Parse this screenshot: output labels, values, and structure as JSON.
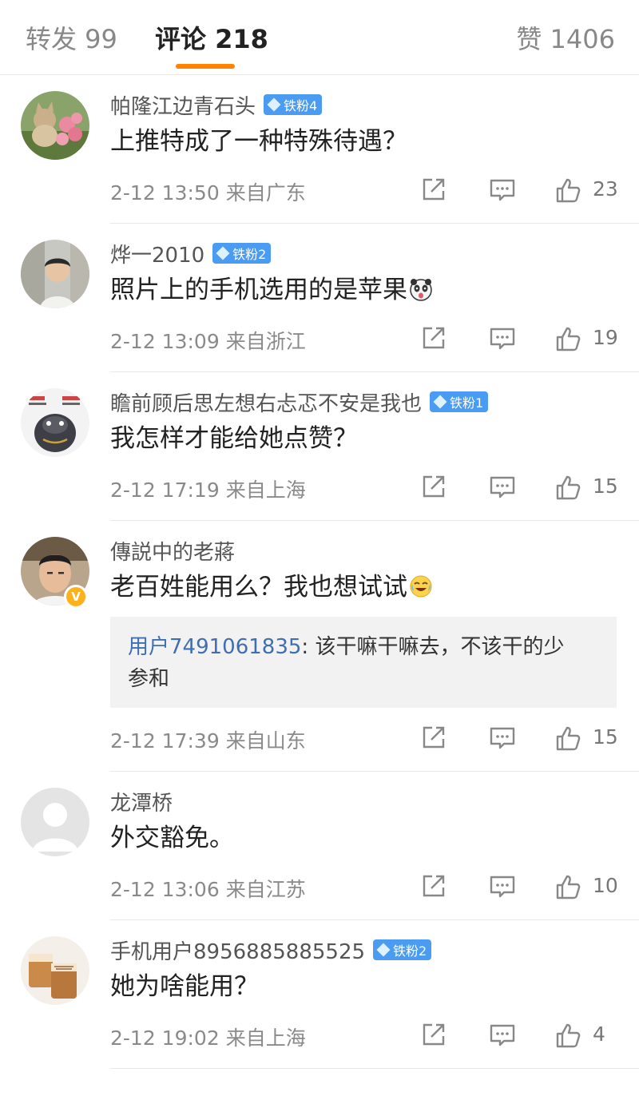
{
  "tabs": {
    "repost": "转发 99",
    "comments": "评论 218",
    "likes": "赞 1406",
    "active": "comments",
    "accent_color": "#ff8200"
  },
  "comments": [
    {
      "avatar": "cat-with-flowers-avatar",
      "name": "帕隆江边青石头",
      "badge": "铁粉4",
      "content": "上推特成了一种特殊待遇？",
      "time": "2-12 13:50",
      "location": "来自广东",
      "likes": "23"
    },
    {
      "avatar": "boy-photo-avatar",
      "name": "烨一2010",
      "badge": "铁粉2",
      "content": "照片上的手机选用的是苹果",
      "emoji": "panda-tongue-emoji",
      "time": "2-12 13:09",
      "location": "来自浙江",
      "likes": "19"
    },
    {
      "avatar": "meme-creature-avatar",
      "name": "瞻前顾后思左想右忐忑不安是我也",
      "badge": "铁粉1",
      "content": "我怎样才能给她点赞？",
      "time": "2-12 17:19",
      "location": "来自上海",
      "likes": "15"
    },
    {
      "avatar": "man-portrait-avatar",
      "verified": "V",
      "name": "傳説中的老蔣",
      "content": "老百姓能用么？我也想试试",
      "emoji": "laughing-crying-emoji",
      "reply": {
        "user": "用户7491061835",
        "text": ": 该干嘛干嘛去，不该干的少",
        "text2": "参和"
      },
      "time": "2-12 17:39",
      "location": "来自山东",
      "likes": "15"
    },
    {
      "avatar": "default-user-avatar",
      "name": "龙潭桥",
      "content": "外交豁免。",
      "time": "2-12 13:06",
      "location": "来自江苏",
      "likes": "10"
    },
    {
      "avatar": "coffee-cups-avatar",
      "name": "手机用户8956885885525",
      "badge": "铁粉2",
      "content": "她为啥能用？",
      "time": "2-12 19:02",
      "location": "来自上海",
      "likes": "4"
    }
  ]
}
